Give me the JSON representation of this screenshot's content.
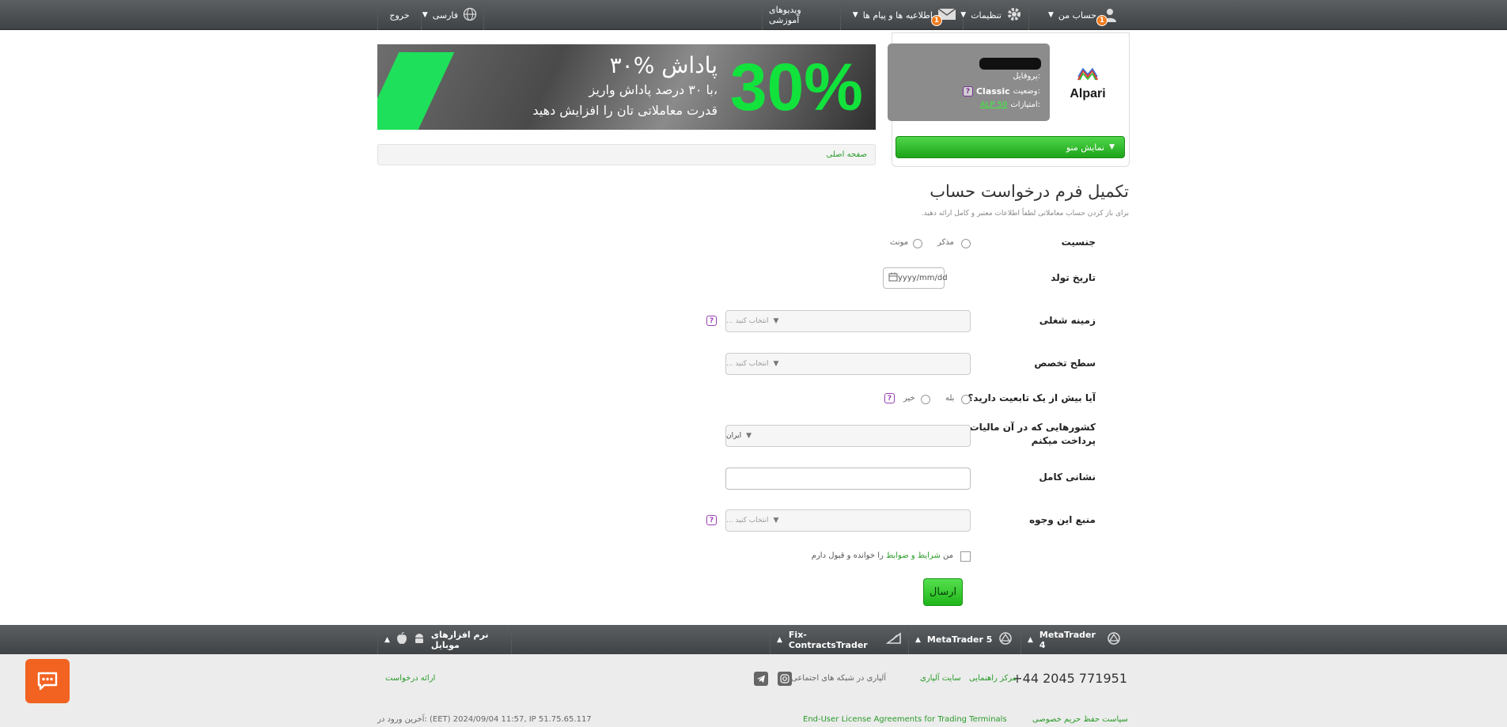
{
  "topbar": {
    "account_label": "حساب من",
    "account_badge": "1",
    "settings_label": "تنظیمات",
    "messages_label": "اطلاعیه ها و پیام ها",
    "messages_badge": "1",
    "videos_label": "ویدیوهای آموزشی",
    "language_label": "فارسی",
    "logout_label": "خروج"
  },
  "profile": {
    "profile_label": "پروفایل:",
    "status_label": "وضعیت:",
    "status_value": "Classic",
    "points_label": "امتیازات:",
    "points_value": "ALP 50",
    "logo_text": "Alpari",
    "menu_button": "نمایش منو"
  },
  "banner": {
    "percent": "30%",
    "line1": "۳۰% پاداش",
    "line2": "با ۳۰ درصد پاداش واریز،",
    "line3": "قدرت معاملاتی تان را افزایش دهید"
  },
  "breadcrumb": {
    "home": "صفحه اصلی"
  },
  "form": {
    "title": "تکمیل فرم درخواست حساب",
    "subtitle": "برای باز کردن حساب معاملاتی لطفاً اطلاعات معتبر و کامل ارائه دهید.",
    "gender_label": "جنسیت",
    "gender_male": "مذکر",
    "gender_female": "مونث",
    "birthdate_label": "تاریخ تولد",
    "birthdate_placeholder": "yyyy/mm/dd",
    "occupation_label": "زمینه شغلی",
    "select_placeholder": "انتخاب کنید ...",
    "expertise_label": "سطح تخصص",
    "multi_citizenship_label": "آیا بیش از یک تابعیت دارید؟",
    "yes": "بله",
    "no": "خیر",
    "tax_country_label": "کشورهایی که در آن مالیات پرداخت میکنم",
    "tax_country_value": "ایران",
    "address_label": "نشانی کامل",
    "funds_source_label": "منبع این وجوه",
    "terms_prefix": "من",
    "terms_link": "شرایط و ضوابط",
    "terms_suffix": "را خوانده و قبول دارم",
    "submit": "ارسال",
    "help_glyph": "?"
  },
  "footbar": {
    "mt4": "MetaTrader 4",
    "mt5": "MetaTrader 5",
    "fix": "Fix-ContractsTrader",
    "mobile": "نرم افزارهای موبایل"
  },
  "footer": {
    "phone": "+44 2045 771951",
    "help_center": "مرکز راهنمایی",
    "alpari_site": "سایت آلپاری",
    "social_text": "آلپاری در شبکه های اجتماعی",
    "feedback": "ارائه درخواست",
    "privacy": "سیاست حفظ حریم خصوصی",
    "eula": "End-User License Agreements for Trading Terminals",
    "last_login": "آخرین ورود در: (EET) 2024/09/04 11:57, IP 51.75.65.117"
  },
  "colors": {
    "accent_green": "#1ea41a",
    "badge_orange": "#f07b1d",
    "chat_orange": "#f26322"
  }
}
